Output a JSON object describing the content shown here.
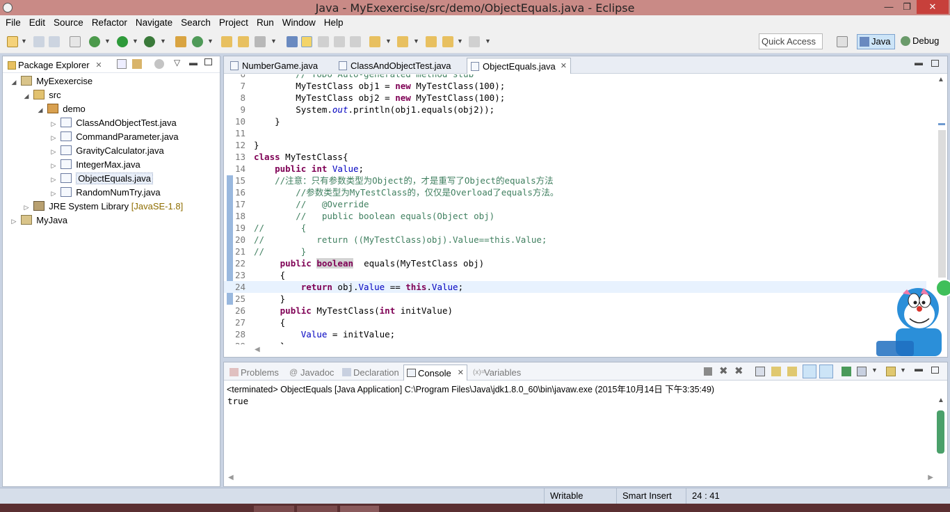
{
  "window": {
    "title": "Java - MyExexercise/src/demo/ObjectEquals.java - Eclipse",
    "minimize": "—",
    "maximize": "❐",
    "close": "✕"
  },
  "menubar": [
    "File",
    "Edit",
    "Source",
    "Refactor",
    "Navigate",
    "Search",
    "Project",
    "Run",
    "Window",
    "Help"
  ],
  "toolbar": {
    "quick_access_placeholder": "Quick Access",
    "perspective_java": "Java",
    "perspective_debug": "Debug"
  },
  "package_explorer": {
    "tab_label": "Package Explorer",
    "tree": [
      {
        "label": "MyExexercise",
        "type": "project",
        "level": 0,
        "toggle": "◢"
      },
      {
        "label": "src",
        "type": "srcfolder",
        "level": 1,
        "toggle": "◢"
      },
      {
        "label": "demo",
        "type": "package",
        "level": 2,
        "toggle": "◢"
      },
      {
        "label": "ClassAndObjectTest.java",
        "type": "javafile",
        "level": 3,
        "toggle": "▷"
      },
      {
        "label": "CommandParameter.java",
        "type": "javafile",
        "level": 3,
        "toggle": "▷"
      },
      {
        "label": "GravityCalculator.java",
        "type": "javafile",
        "level": 3,
        "toggle": "▷"
      },
      {
        "label": "IntegerMax.java",
        "type": "javafile",
        "level": 3,
        "toggle": "▷"
      },
      {
        "label": "ObjectEquals.java",
        "type": "javafile",
        "level": 3,
        "toggle": "▷",
        "selected": true
      },
      {
        "label": "RandomNumTry.java",
        "type": "javafile",
        "level": 3,
        "toggle": "▷"
      },
      {
        "label": "JRE System Library",
        "type": "library",
        "level": 1,
        "toggle": "▷",
        "tag": "[JavaSE-1.8]"
      },
      {
        "label": "MyJava",
        "type": "project",
        "level": 0,
        "toggle": "▷"
      }
    ]
  },
  "editor": {
    "tabs": [
      {
        "label": "NumberGame.java",
        "active": false
      },
      {
        "label": "ClassAndObjectTest.java",
        "active": false
      },
      {
        "label": "ObjectEquals.java",
        "active": true
      }
    ],
    "lines": [
      {
        "n": "6",
        "spans": [
          {
            "t": "        ",
            "c": ""
          },
          {
            "t": "// TODO Auto-generated method stub",
            "c": "cm"
          }
        ]
      },
      {
        "n": "7",
        "spans": [
          {
            "t": "        MyTestClass obj1 = ",
            "c": ""
          },
          {
            "t": "new",
            "c": "kw"
          },
          {
            "t": " MyTestClass(100);",
            "c": ""
          }
        ]
      },
      {
        "n": "8",
        "spans": [
          {
            "t": "        MyTestClass obj2 = ",
            "c": ""
          },
          {
            "t": "new",
            "c": "kw"
          },
          {
            "t": " MyTestClass(100);",
            "c": ""
          }
        ]
      },
      {
        "n": "9",
        "spans": [
          {
            "t": "        System.",
            "c": ""
          },
          {
            "t": "out",
            "c": "stfld"
          },
          {
            "t": ".println(obj1.equals(obj2));",
            "c": ""
          }
        ]
      },
      {
        "n": "10",
        "spans": [
          {
            "t": "    }",
            "c": ""
          }
        ]
      },
      {
        "n": "11",
        "spans": []
      },
      {
        "n": "12",
        "spans": [
          {
            "t": "}",
            "c": ""
          }
        ]
      },
      {
        "n": "13",
        "spans": [
          {
            "t": "class",
            "c": "kw"
          },
          {
            "t": " MyTestClass{",
            "c": ""
          }
        ]
      },
      {
        "n": "14",
        "spans": [
          {
            "t": "    ",
            "c": ""
          },
          {
            "t": "public",
            "c": "kw"
          },
          {
            "t": " ",
            "c": ""
          },
          {
            "t": "int",
            "c": "kw"
          },
          {
            "t": " ",
            "c": ""
          },
          {
            "t": "Value",
            "c": "fld"
          },
          {
            "t": ";",
            "c": ""
          }
        ]
      },
      {
        "n": "15",
        "spans": [
          {
            "t": "    ",
            "c": ""
          },
          {
            "t": "//注意：只有参数类型为Object的，才是重写了Object的equals方法",
            "c": "cm"
          }
        ]
      },
      {
        "n": "16",
        "spans": [
          {
            "t": "        ",
            "c": ""
          },
          {
            "t": "//参数类型为MyTestClass的，仅仅是Overload了equals方法。",
            "c": "cm"
          }
        ]
      },
      {
        "n": "17",
        "spans": [
          {
            "t": "        ",
            "c": ""
          },
          {
            "t": "//   @Override",
            "c": "cm"
          }
        ]
      },
      {
        "n": "18",
        "spans": [
          {
            "t": "        ",
            "c": ""
          },
          {
            "t": "//   public boolean equals(Object obj)",
            "c": "cm"
          }
        ]
      },
      {
        "n": "19",
        "spans": [
          {
            "t": "//       {",
            "c": "cm"
          }
        ]
      },
      {
        "n": "20",
        "spans": [
          {
            "t": "//          return ((MyTestClass)obj).Value==this.Value;",
            "c": "cm"
          }
        ]
      },
      {
        "n": "21",
        "spans": [
          {
            "t": "//       }",
            "c": "cm"
          }
        ]
      },
      {
        "n": "22",
        "spans": [
          {
            "t": "     ",
            "c": ""
          },
          {
            "t": "public",
            "c": "kw"
          },
          {
            "t": " ",
            "c": ""
          },
          {
            "t": "boolean",
            "c": "kw hl"
          },
          {
            "t": "  equals(MyTestClass obj)",
            "c": ""
          }
        ]
      },
      {
        "n": "23",
        "spans": [
          {
            "t": "     {",
            "c": ""
          }
        ]
      },
      {
        "n": "24",
        "current": true,
        "spans": [
          {
            "t": "         ",
            "c": ""
          },
          {
            "t": "return",
            "c": "kw"
          },
          {
            "t": " obj.",
            "c": ""
          },
          {
            "t": "Value",
            "c": "fld"
          },
          {
            "t": " == ",
            "c": ""
          },
          {
            "t": "this",
            "c": "kw"
          },
          {
            "t": ".",
            "c": ""
          },
          {
            "t": "Value",
            "c": "fld"
          },
          {
            "t": ";",
            "c": ""
          }
        ]
      },
      {
        "n": "25",
        "spans": [
          {
            "t": "     }",
            "c": ""
          }
        ]
      },
      {
        "n": "26",
        "spans": [
          {
            "t": "     ",
            "c": ""
          },
          {
            "t": "public",
            "c": "kw"
          },
          {
            "t": " MyTestClass(",
            "c": ""
          },
          {
            "t": "int",
            "c": "kw"
          },
          {
            "t": " initValue)",
            "c": ""
          }
        ]
      },
      {
        "n": "27",
        "spans": [
          {
            "t": "     {",
            "c": ""
          }
        ]
      },
      {
        "n": "28",
        "spans": [
          {
            "t": "         ",
            "c": ""
          },
          {
            "t": "Value",
            "c": "fld"
          },
          {
            "t": " = initValue;",
            "c": ""
          }
        ]
      },
      {
        "n": "29",
        "spans": [
          {
            "t": "     }",
            "c": ""
          }
        ]
      }
    ]
  },
  "console": {
    "tabs": [
      {
        "label": "Problems",
        "active": false
      },
      {
        "label": "Javadoc",
        "active": false
      },
      {
        "label": "Declaration",
        "active": false
      },
      {
        "label": "Console",
        "active": true
      },
      {
        "label": "Variables",
        "active": false
      }
    ],
    "header": "<terminated> ObjectEquals [Java Application] C:\\Program Files\\Java\\jdk1.8.0_60\\bin\\javaw.exe (2015年10月14日 下午3:35:49)",
    "output": "true"
  },
  "statusbar": {
    "writable": "Writable",
    "insert_mode": "Smart Insert",
    "position": "24 : 41"
  },
  "colors": {
    "keyword": "#7f0055",
    "comment": "#3f7f5f",
    "field": "#0000c0",
    "titlebar": "#c98a86"
  }
}
